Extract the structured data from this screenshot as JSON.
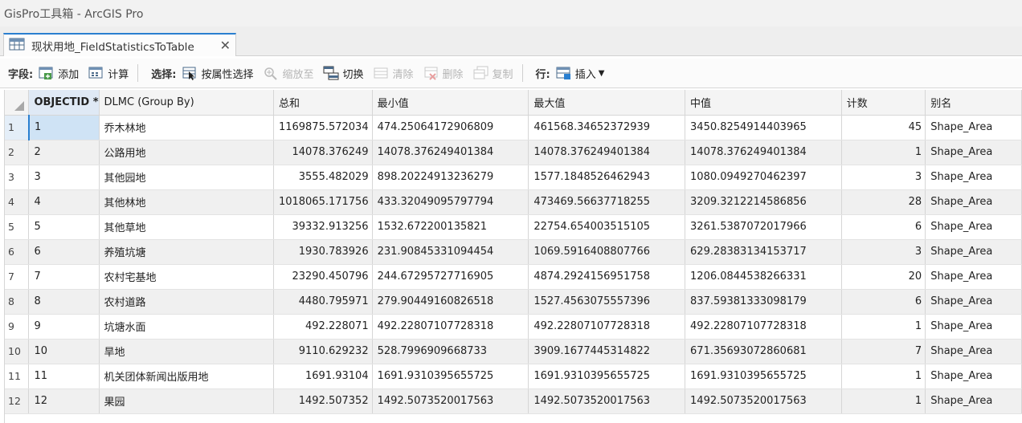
{
  "window": {
    "title": "GisPro工具箱 - ArcGIS Pro"
  },
  "tab": {
    "label": "现状用地_FieldStatisticsToTable",
    "close": "✕"
  },
  "toolbar": {
    "field_label": "字段:",
    "add": "添加",
    "calculate": "计算",
    "select_label": "选择:",
    "select_by_attr": "按属性选择",
    "zoom_to": "缩放至",
    "switch": "切换",
    "clear": "清除",
    "delete": "删除",
    "copy": "复制",
    "row_label": "行:",
    "insert": "插入"
  },
  "table": {
    "columns": [
      "OBJECTID *",
      "DLMC (Group By)",
      "总和",
      "最小值",
      "最大值",
      "中值",
      "计数",
      "别名"
    ],
    "rows": [
      {
        "n": "1",
        "oid": "1",
        "dlmc": "乔木林地",
        "sum": "1169875.572034",
        "min": "474.25064172906809",
        "max": "461568.34652372939",
        "median": "3450.8254914403965",
        "count": "45",
        "alias": "Shape_Area"
      },
      {
        "n": "2",
        "oid": "2",
        "dlmc": "公路用地",
        "sum": "14078.376249",
        "min": "14078.376249401384",
        "max": "14078.376249401384",
        "median": "14078.376249401384",
        "count": "1",
        "alias": "Shape_Area"
      },
      {
        "n": "3",
        "oid": "3",
        "dlmc": "其他园地",
        "sum": "3555.482029",
        "min": "898.20224913236279",
        "max": "1577.1848526462943",
        "median": "1080.0949270462397",
        "count": "3",
        "alias": "Shape_Area"
      },
      {
        "n": "4",
        "oid": "4",
        "dlmc": "其他林地",
        "sum": "1018065.171756",
        "min": "433.32049095797794",
        "max": "473469.56637718255",
        "median": "3209.3212214586856",
        "count": "28",
        "alias": "Shape_Area"
      },
      {
        "n": "5",
        "oid": "5",
        "dlmc": "其他草地",
        "sum": "39332.913256",
        "min": "1532.672200135821",
        "max": "22754.654003515105",
        "median": "3261.5387072017966",
        "count": "6",
        "alias": "Shape_Area"
      },
      {
        "n": "6",
        "oid": "6",
        "dlmc": "养殖坑塘",
        "sum": "1930.783926",
        "min": "231.90845331094454",
        "max": "1069.5916408807766",
        "median": "629.28383134153717",
        "count": "3",
        "alias": "Shape_Area"
      },
      {
        "n": "7",
        "oid": "7",
        "dlmc": "农村宅基地",
        "sum": "23290.450796",
        "min": "244.67295727716905",
        "max": "4874.2924156951758",
        "median": "1206.0844538266331",
        "count": "20",
        "alias": "Shape_Area"
      },
      {
        "n": "8",
        "oid": "8",
        "dlmc": "农村道路",
        "sum": "4480.795971",
        "min": "279.90449160826518",
        "max": "1527.4563075557396",
        "median": "837.59381333098179",
        "count": "6",
        "alias": "Shape_Area"
      },
      {
        "n": "9",
        "oid": "9",
        "dlmc": "坑塘水面",
        "sum": "492.228071",
        "min": "492.22807107728318",
        "max": "492.22807107728318",
        "median": "492.22807107728318",
        "count": "1",
        "alias": "Shape_Area"
      },
      {
        "n": "10",
        "oid": "10",
        "dlmc": "旱地",
        "sum": "9110.629232",
        "min": "528.7996909668733",
        "max": "3909.1677445314822",
        "median": "671.35693072860681",
        "count": "7",
        "alias": "Shape_Area"
      },
      {
        "n": "11",
        "oid": "11",
        "dlmc": "机关团体新闻出版用地",
        "sum": "1691.93104",
        "min": "1691.9310395655725",
        "max": "1691.9310395655725",
        "median": "1691.9310395655725",
        "count": "1",
        "alias": "Shape_Area"
      },
      {
        "n": "12",
        "oid": "12",
        "dlmc": "果园",
        "sum": "1492.507352",
        "min": "1492.5073520017563",
        "max": "1492.5073520017563",
        "median": "1492.5073520017563",
        "count": "1",
        "alias": "Shape_Area"
      }
    ]
  },
  "colors": {
    "accent": "#2a7fd0",
    "header_bg": "#f4f4f4",
    "alt_row": "#f0f0f0"
  }
}
